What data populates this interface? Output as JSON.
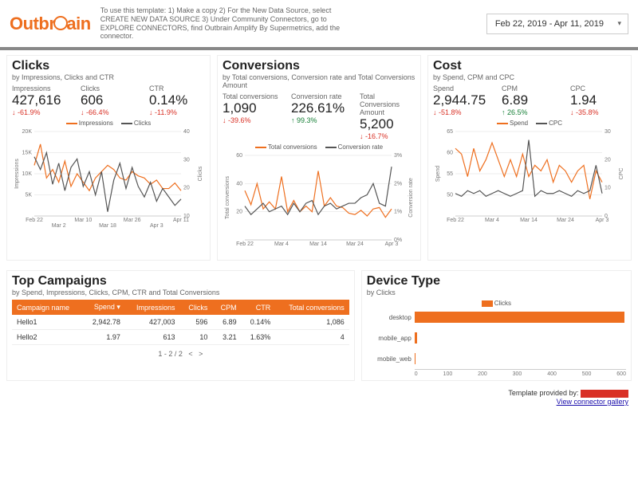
{
  "header": {
    "logo_text_left": "Outbr",
    "logo_text_right": "ain",
    "instructions": "To use this template: 1) Make a copy 2) For the New Data Source, select CREATE NEW DATA SOURCE 3) Under Community Connectors, go to EXPLORE CONNECTORS, find Outbrain Amplify By Supermetrics, add the connector.",
    "daterange": "Feb 22, 2019 - Apr 11, 2019"
  },
  "panels": {
    "clicks": {
      "title": "Clicks",
      "subtitle": "by Impressions, Clicks and CTR",
      "metrics": [
        {
          "label": "Impressions",
          "value": "427,616",
          "delta": "-61.9%",
          "dir": "neg"
        },
        {
          "label": "Clicks",
          "value": "606",
          "delta": "-66.4%",
          "dir": "neg"
        },
        {
          "label": "CTR",
          "value": "0.14%",
          "delta": "-11.9%",
          "dir": "neg"
        }
      ],
      "legend": [
        {
          "name": "Impressions",
          "color": "#ee6f1f"
        },
        {
          "name": "Clicks",
          "color": "#555"
        }
      ]
    },
    "conversions": {
      "title": "Conversions",
      "subtitle": "by Total conversions, Conversion rate and Total Conversions Amount",
      "metrics": [
        {
          "label": "Total conversions",
          "value": "1,090",
          "delta": "-39.6%",
          "dir": "neg"
        },
        {
          "label": "Conversion rate",
          "value": "226.61%",
          "delta": "99.3%",
          "dir": "pos"
        },
        {
          "label": "Total Conversions Amount",
          "value": "5,200",
          "delta": "-16.7%",
          "dir": "neg"
        }
      ],
      "legend": [
        {
          "name": "Total conversions",
          "color": "#ee6f1f"
        },
        {
          "name": "Conversion rate",
          "color": "#555"
        }
      ]
    },
    "cost": {
      "title": "Cost",
      "subtitle": "by Spend, CPM and CPC",
      "metrics": [
        {
          "label": "Spend",
          "value": "2,944.75",
          "delta": "-51.8%",
          "dir": "neg"
        },
        {
          "label": "CPM",
          "value": "6.89",
          "delta": "26.5%",
          "dir": "pos"
        },
        {
          "label": "CPC",
          "value": "1.94",
          "delta": "-35.8%",
          "dir": "neg"
        }
      ],
      "legend": [
        {
          "name": "Spend",
          "color": "#ee6f1f"
        },
        {
          "name": "CPC",
          "color": "#555"
        }
      ]
    }
  },
  "campaigns": {
    "title": "Top Campaigns",
    "subtitle": "by Spend, Impressions, Clicks, CPM, CTR and Total Conversions",
    "headers": [
      "Campaign name",
      "Spend ▾",
      "Impressions",
      "Clicks",
      "CPM",
      "CTR",
      "Total conversions"
    ],
    "rows": [
      [
        "Hello1",
        "2,942.78",
        "427,003",
        "596",
        "6.89",
        "0.14%",
        "1,086"
      ],
      [
        "Hello2",
        "1.97",
        "613",
        "10",
        "3.21",
        "1.63%",
        "4"
      ]
    ],
    "pager": "1 - 2 / 2"
  },
  "device": {
    "title": "Device Type",
    "subtitle": "by Clicks",
    "legend": "Clicks",
    "axis": [
      "0",
      "100",
      "200",
      "300",
      "400",
      "500",
      "600"
    ]
  },
  "footer": {
    "text": "Template provided by:",
    "link": "View connector gallery"
  },
  "chart_data": [
    {
      "type": "line",
      "title": "Clicks",
      "x_ticks": [
        "Feb 22",
        "Mar 2",
        "Mar 10",
        "Mar 18",
        "Mar 26",
        "Apr 3",
        "Apr 11"
      ],
      "y_left": {
        "label": "Impressions",
        "range": [
          0,
          20000
        ],
        "ticks": [
          "5K",
          "10K",
          "15K",
          "20K"
        ]
      },
      "y_right": {
        "label": "Clicks",
        "range": [
          0,
          40
        ],
        "ticks": [
          "10",
          "20",
          "30",
          "40"
        ]
      },
      "series": [
        {
          "name": "Impressions",
          "color": "#ee6f1f",
          "axis": "left",
          "values": [
            12000,
            17000,
            9000,
            11000,
            8000,
            13000,
            7000,
            10000,
            8000,
            6000,
            9000,
            10500,
            12000,
            11000,
            9000,
            8500,
            10500,
            9500,
            9000,
            7500,
            8500,
            6500,
            6500,
            7800,
            6000
          ]
        },
        {
          "name": "Clicks",
          "color": "#555",
          "axis": "right",
          "values": [
            28,
            22,
            30,
            15,
            25,
            12,
            23,
            27,
            14,
            21,
            10,
            21,
            2,
            17,
            25,
            13,
            23,
            14,
            9,
            16,
            7,
            13,
            9,
            5,
            8
          ]
        }
      ]
    },
    {
      "type": "line",
      "title": "Conversions",
      "x_ticks": [
        "Feb 22",
        "Mar 4",
        "Mar 14",
        "Mar 24",
        "Apr 3"
      ],
      "y_left": {
        "label": "Total conversions",
        "range": [
          0,
          60
        ],
        "ticks": [
          "20",
          "40",
          "60"
        ]
      },
      "y_right": {
        "label": "Conversion rate",
        "range": [
          0,
          0.03
        ],
        "ticks": [
          "0%",
          "1%",
          "2%",
          "3%"
        ]
      },
      "series": [
        {
          "name": "Total conversions",
          "color": "#ee6f1f",
          "axis": "left",
          "values": [
            35,
            25,
            40,
            22,
            27,
            22,
            45,
            20,
            28,
            20,
            24,
            20,
            49,
            24,
            30,
            24,
            23,
            19,
            18,
            21,
            17,
            22,
            23,
            16,
            22
          ]
        },
        {
          "name": "Conversion rate",
          "color": "#555",
          "axis": "right",
          "values": [
            0.012,
            0.009,
            0.011,
            0.013,
            0.01,
            0.011,
            0.012,
            0.009,
            0.013,
            0.01,
            0.013,
            0.014,
            0.009,
            0.012,
            0.013,
            0.011,
            0.012,
            0.013,
            0.013,
            0.015,
            0.016,
            0.02,
            0.013,
            0.012,
            0.026
          ]
        }
      ]
    },
    {
      "type": "line",
      "title": "Cost",
      "x_ticks": [
        "Feb 22",
        "Mar 4",
        "Mar 14",
        "Mar 24",
        "Apr 3"
      ],
      "y_left": {
        "label": "Spend",
        "range": [
          50,
          65
        ],
        "ticks": [
          "50",
          "55",
          "60",
          "65"
        ]
      },
      "y_right": {
        "label": "CPC",
        "range": [
          0,
          30
        ],
        "ticks": [
          "0",
          "10",
          "20",
          "30"
        ]
      },
      "series": [
        {
          "name": "Spend",
          "color": "#ee6f1f",
          "axis": "left",
          "values": [
            62,
            61,
            57,
            62,
            58,
            60,
            63,
            60,
            57,
            60,
            57,
            61,
            57,
            59,
            58,
            60,
            56,
            59,
            58,
            56,
            58,
            59,
            53,
            58,
            56
          ]
        },
        {
          "name": "CPC",
          "color": "#555",
          "axis": "right",
          "values": [
            8,
            7,
            9,
            8,
            9,
            7,
            8,
            9,
            8,
            7,
            8,
            9,
            27,
            7,
            9,
            8,
            8,
            9,
            8,
            7,
            9,
            8,
            9,
            18,
            8
          ]
        }
      ]
    },
    {
      "type": "bar",
      "title": "Device Type",
      "categories": [
        "desktop",
        "mobile_app",
        "mobile_web"
      ],
      "values": [
        595,
        8,
        3
      ],
      "xlabel": "",
      "ylabel": "Clicks",
      "xlim": [
        0,
        600
      ]
    }
  ]
}
